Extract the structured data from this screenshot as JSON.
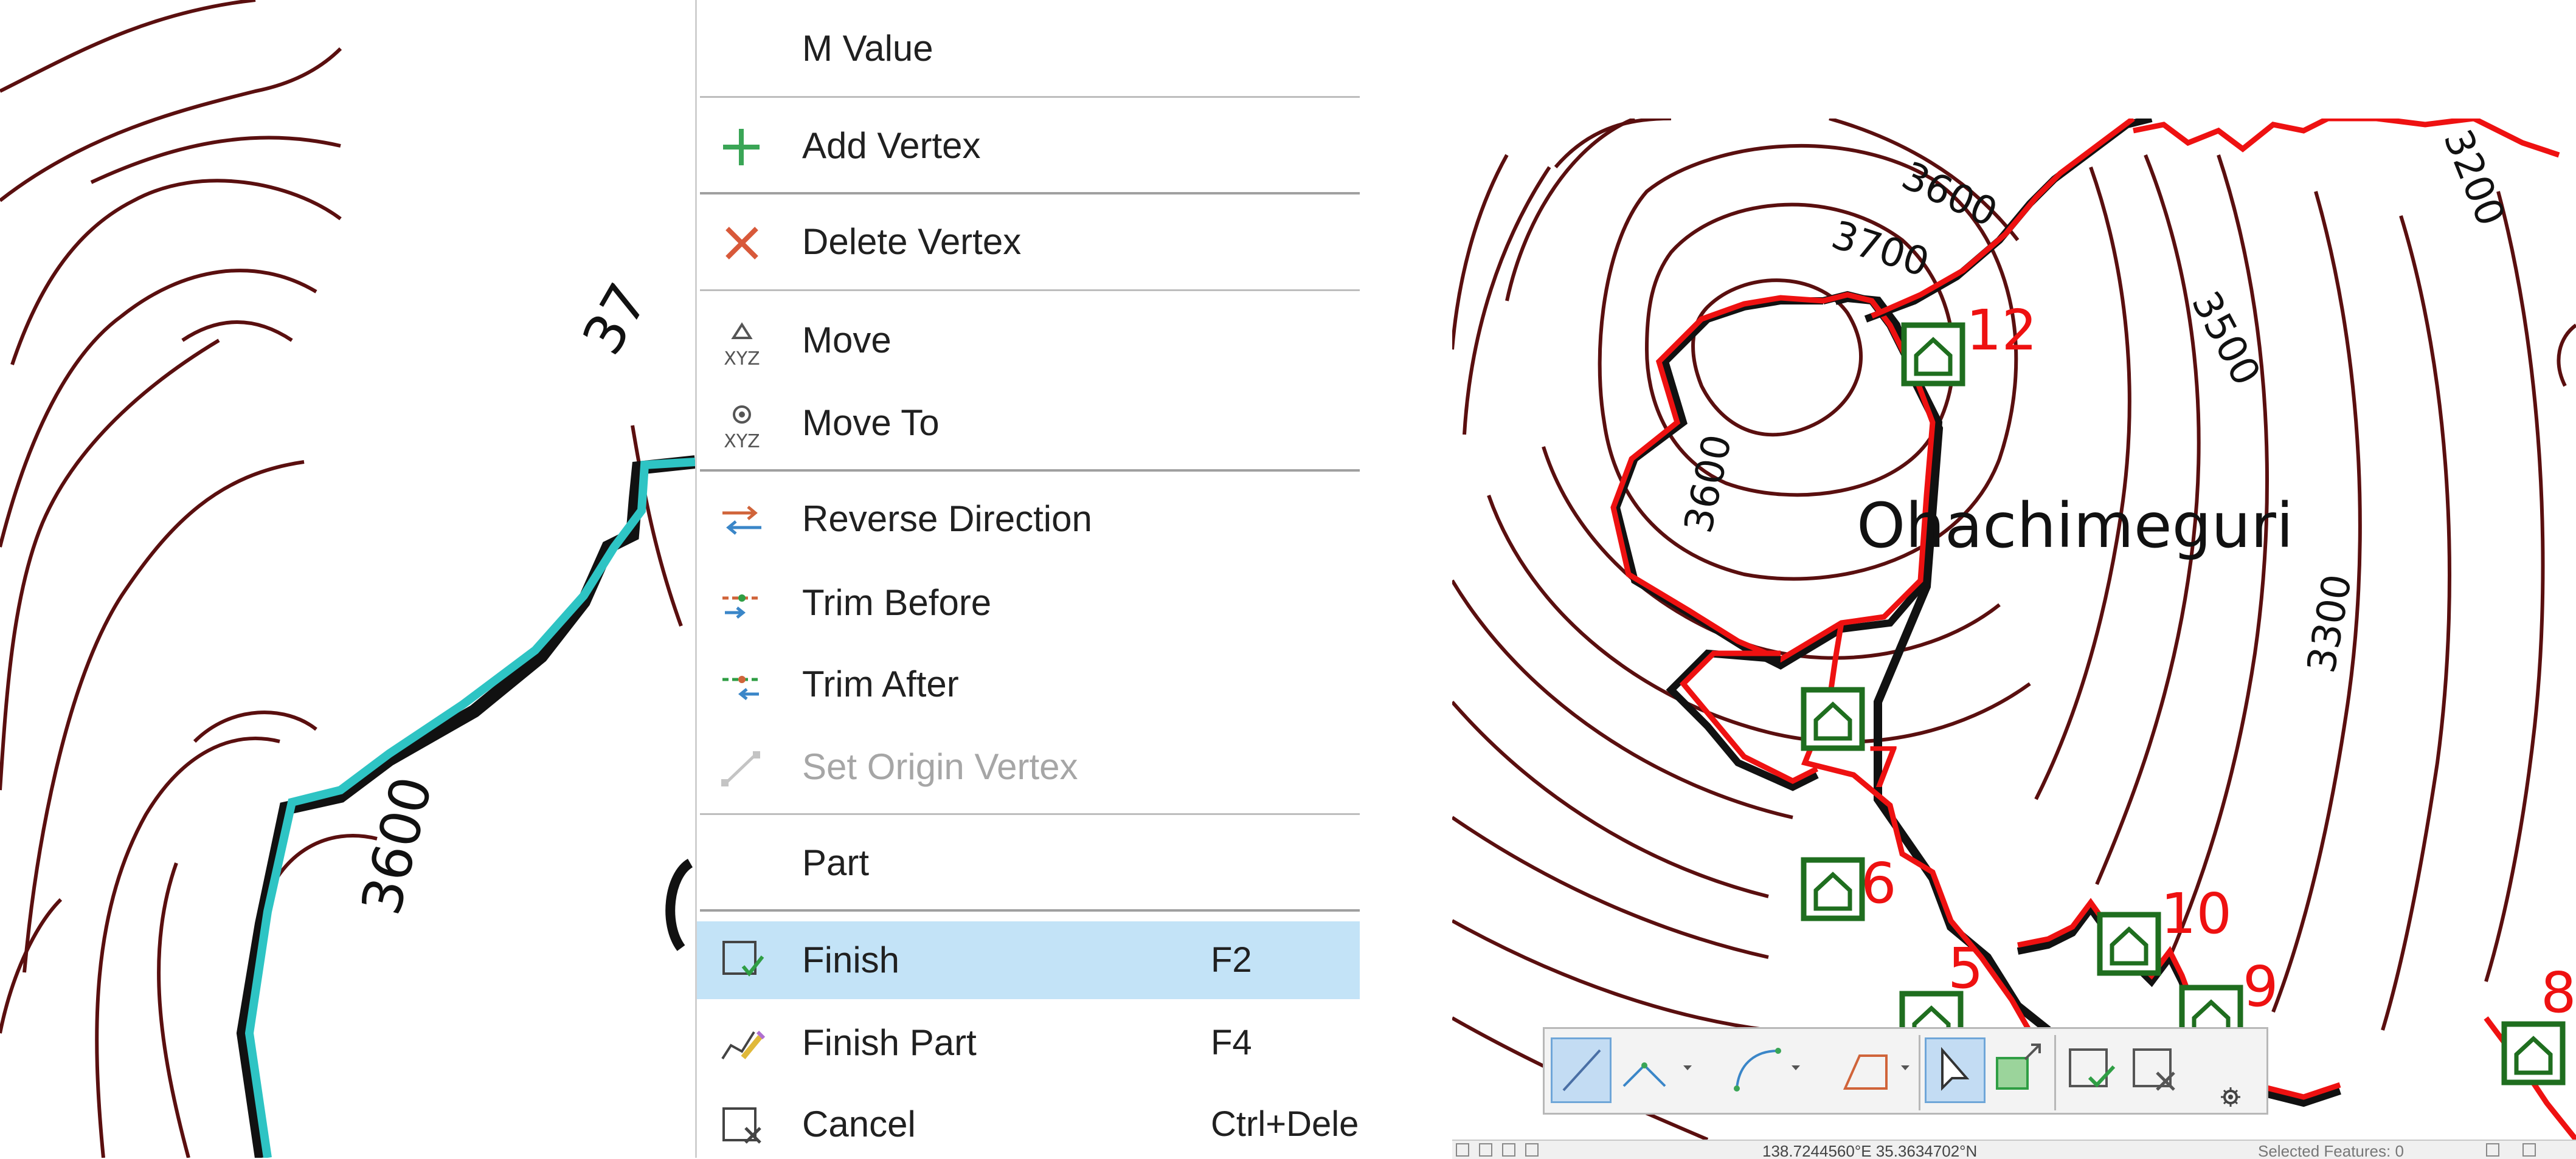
{
  "left_map": {
    "contour_labels": [
      "37",
      "3600"
    ],
    "trail_color": "#2ec4c4",
    "contour_color": "#5a0f0f"
  },
  "context_menu": {
    "items": [
      {
        "label": "M Value",
        "shortcut": "",
        "icon": "none",
        "disabled": false,
        "active": false
      },
      {
        "label": "Add Vertex",
        "shortcut": "",
        "icon": "plus-icon",
        "disabled": false,
        "active": false
      },
      {
        "label": "Delete Vertex",
        "shortcut": "",
        "icon": "x-mark-icon",
        "disabled": false,
        "active": false
      },
      {
        "label": "Move",
        "shortcut": "",
        "icon": "move-xyz-icon",
        "icon_text": "XYZ",
        "disabled": false,
        "active": false
      },
      {
        "label": "Move To",
        "shortcut": "",
        "icon": "move-to-xyz-icon",
        "icon_text": "XYZ",
        "disabled": false,
        "active": false
      },
      {
        "label": "Reverse Direction",
        "shortcut": "",
        "icon": "reverse-direction-icon",
        "disabled": false,
        "active": false
      },
      {
        "label": "Trim Before",
        "shortcut": "",
        "icon": "trim-before-icon",
        "disabled": false,
        "active": false
      },
      {
        "label": "Trim After",
        "shortcut": "",
        "icon": "trim-after-icon",
        "disabled": false,
        "active": false
      },
      {
        "label": "Set Origin Vertex",
        "shortcut": "",
        "icon": "set-origin-vertex-icon",
        "disabled": true,
        "active": false
      },
      {
        "label": "Part",
        "shortcut": "",
        "icon": "none",
        "disabled": false,
        "active": false
      },
      {
        "label": "Finish",
        "shortcut": "F2",
        "icon": "finish-icon",
        "disabled": false,
        "active": true
      },
      {
        "label": "Finish Part",
        "shortcut": "F4",
        "icon": "finish-part-icon",
        "disabled": false,
        "active": false
      },
      {
        "label": "Cancel",
        "shortcut": "Ctrl+Dele",
        "icon": "cancel-sketch-icon",
        "disabled": false,
        "active": false
      }
    ],
    "highlight_color": "#c3e3f7"
  },
  "right_map": {
    "contour_labels": [
      "3600",
      "3700",
      "3500",
      "3300",
      "3200",
      "3600"
    ],
    "place_label": "Ohachimeguri",
    "hut_numbers": [
      "12",
      "7",
      "6",
      "5",
      "10",
      "9",
      "8"
    ],
    "trail_color": "#ee1111",
    "hut_color": "#1f6e1f"
  },
  "edit_toolbar": {
    "tools": [
      {
        "name": "line-segment-tool",
        "icon": "line-segment-icon",
        "active": true
      },
      {
        "name": "vertex-tool",
        "icon": "vertex-angle-icon",
        "active": false
      },
      {
        "name": "arc-tool",
        "icon": "arc-icon",
        "active": false
      },
      {
        "name": "right-angle-tool",
        "icon": "right-angle-icon",
        "active": false
      },
      {
        "name": "select-tool",
        "icon": "select-arrow-icon",
        "active": true
      },
      {
        "name": "select-by-shape-tool",
        "icon": "select-shape-icon",
        "active": false
      },
      {
        "name": "finish-sketch-tool",
        "icon": "finish-sketch-icon",
        "active": false
      },
      {
        "name": "cancel-sketch-tool",
        "icon": "cancel-sketch-icon",
        "active": false
      }
    ]
  },
  "status_bar": {
    "coordinates": "138.7244560°E 35.3634702°N",
    "selected_features": "Selected Features: 0"
  }
}
